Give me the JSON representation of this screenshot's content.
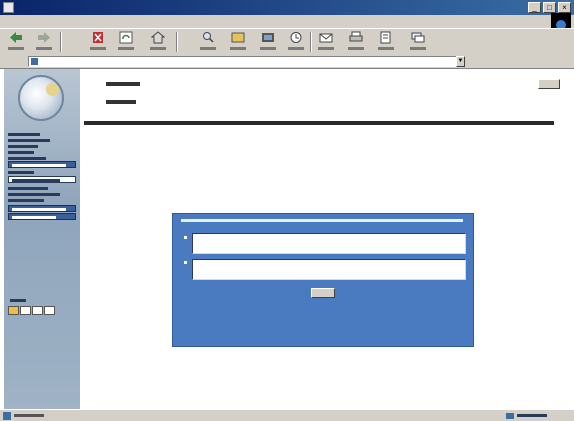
{
  "window": {
    "title": ""
  },
  "menu": {
    "items": [
      "",
      "",
      "",
      "",
      "",
      ""
    ]
  },
  "toolbar": {
    "buttons": [
      {
        "icon": "back-arrow-icon"
      },
      {
        "icon": "forward-arrow-icon"
      },
      {
        "icon": "stop-icon"
      },
      {
        "icon": "refresh-icon"
      },
      {
        "icon": "home-icon"
      },
      {
        "icon": "search-icon"
      },
      {
        "icon": "favorites-icon"
      },
      {
        "icon": "media-icon"
      },
      {
        "icon": "history-icon"
      },
      {
        "icon": "mail-icon"
      },
      {
        "icon": "print-icon"
      },
      {
        "icon": "edit-icon"
      },
      {
        "icon": "discuss-icon"
      }
    ]
  },
  "address": {
    "label": "",
    "url": "",
    "go_label": "",
    "links_label": ""
  },
  "sidebar": {
    "nav_items": [
      "",
      "",
      "",
      "",
      "",
      "",
      "",
      "",
      "",
      "",
      "",
      "",
      ""
    ],
    "pager_label": "",
    "pages": [
      "",
      "",
      "",
      ""
    ]
  },
  "content": {
    "help_label": "",
    "title": "",
    "subtitle": "",
    "question": ""
  },
  "exercise": {
    "instructions": "",
    "answers": [
      {
        "number": "1",
        "placeholder": ""
      },
      {
        "number": "2",
        "placeholder": ""
      }
    ],
    "done_label": ""
  },
  "status": {
    "text": "",
    "zone": ""
  },
  "colors": {
    "titlebar": "#0a246a",
    "panel": "#4a7ac0",
    "sidebar": "#9fb2c6",
    "chrome": "#d4d0c8"
  }
}
